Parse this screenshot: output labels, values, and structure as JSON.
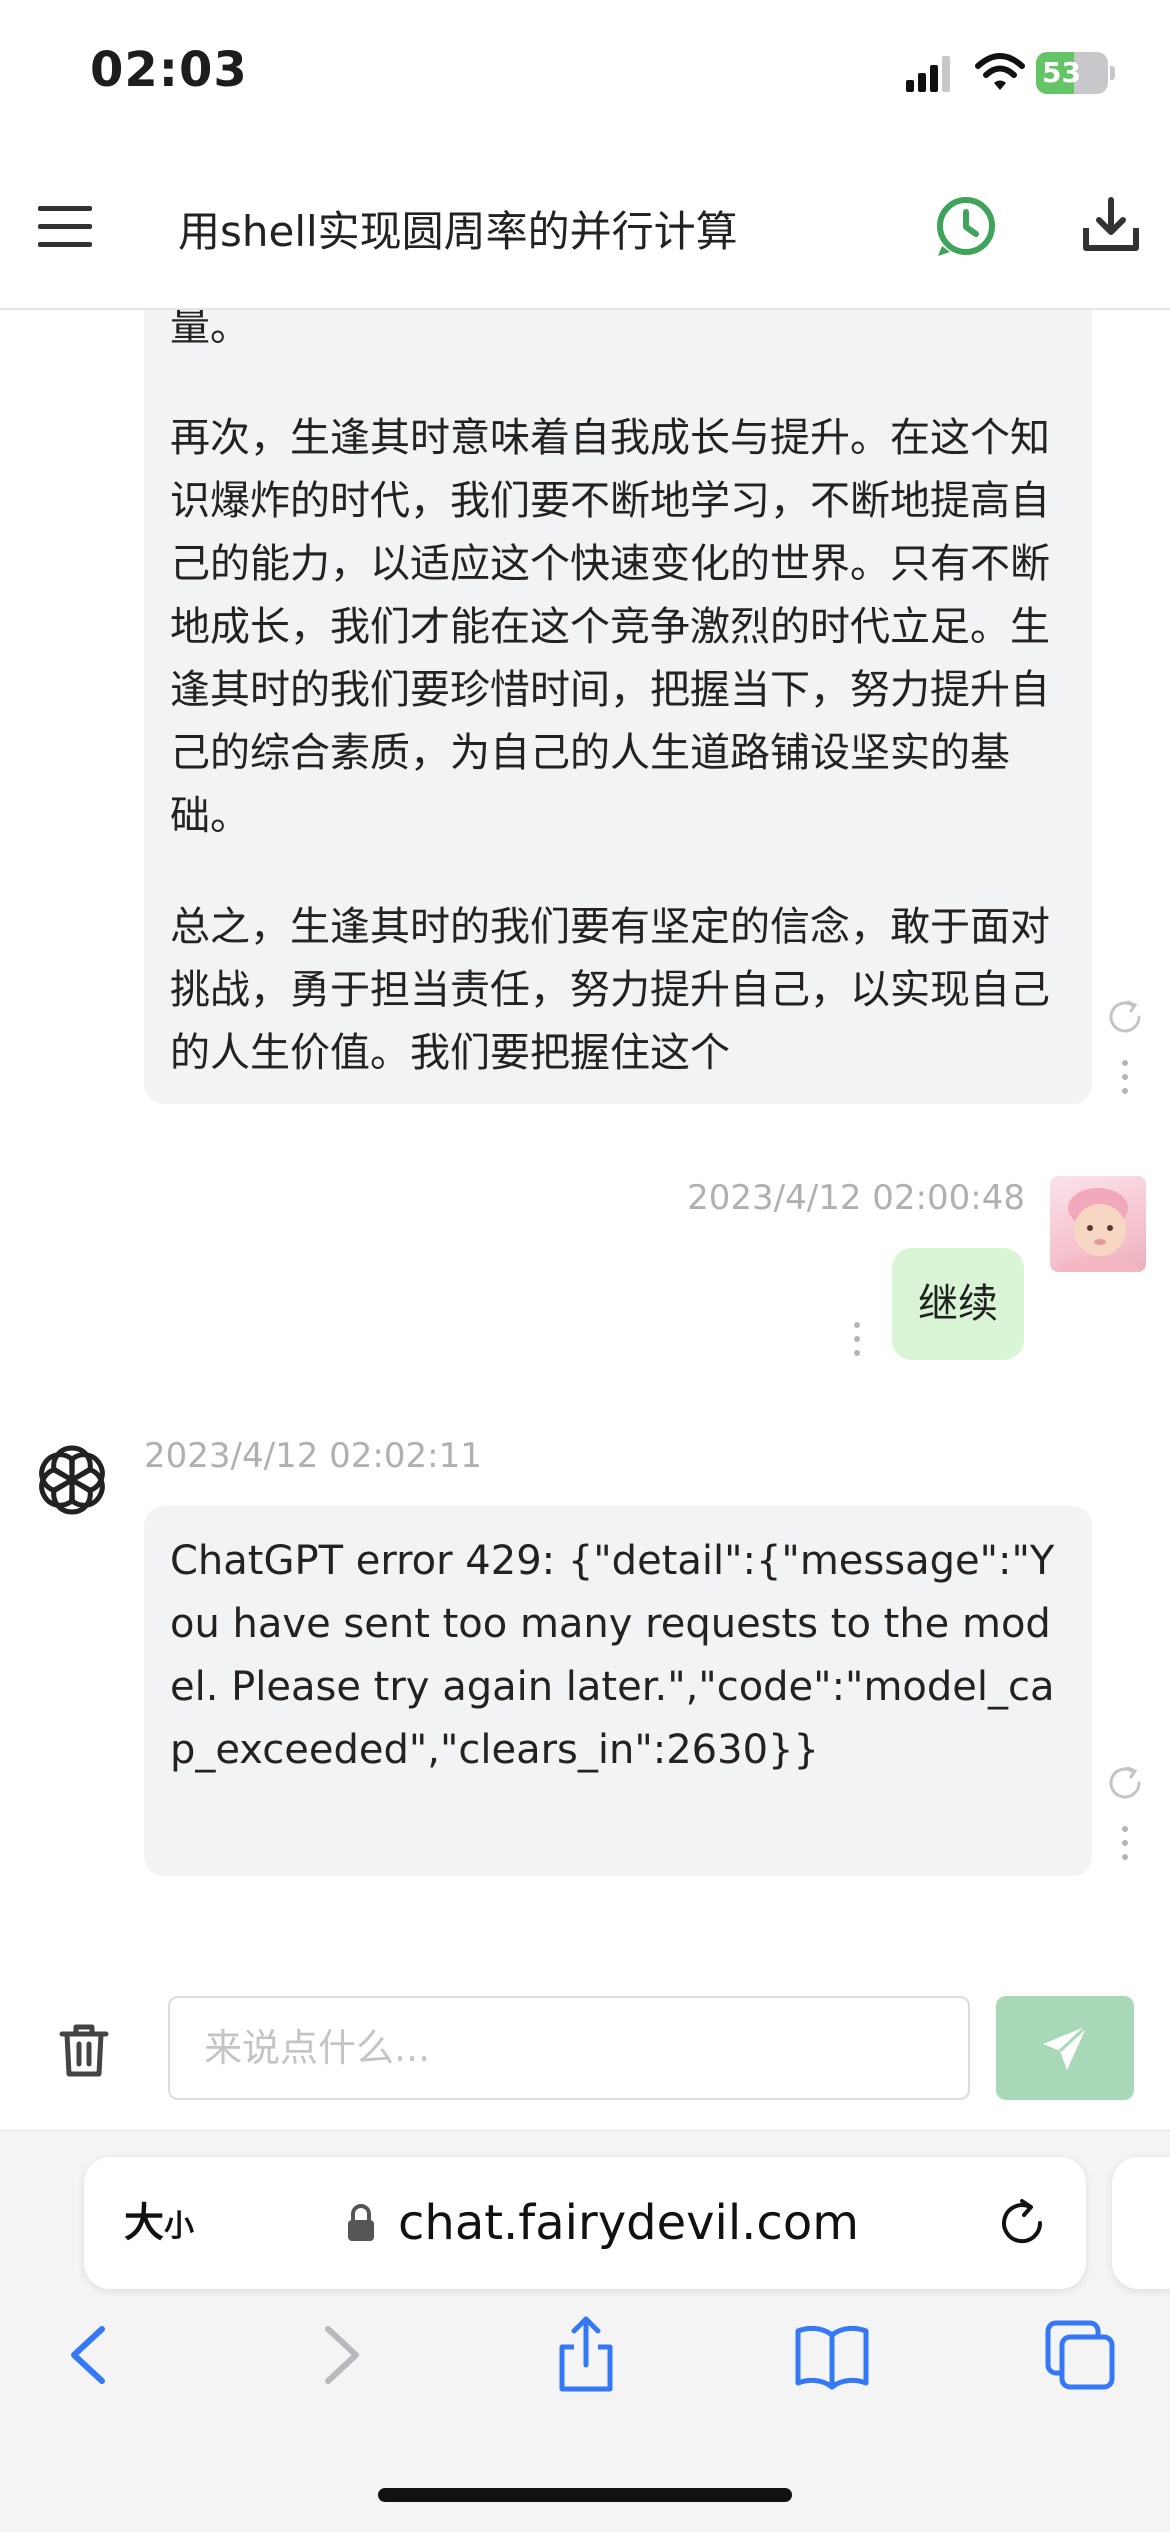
{
  "status_bar": {
    "time": "02:03",
    "battery_level": "53",
    "battery_fraction": 0.53
  },
  "header": {
    "title": "用shell实现圆周率的并行计算"
  },
  "messages": [
    {
      "role": "assistant",
      "paragraphs": [
        "量。",
        "再次，生逢其时意味着自我成长与提升。在这个知识爆炸的时代，我们要不断地学习，不断地提高自己的能力，以适应这个快速变化的世界。只有不断地成长，我们才能在这个竞争激烈的时代立足。生逢其时的我们要珍惜时间，把握当下，努力提升自己的综合素质，为自己的人生道路铺设坚实的基础。",
        "总之，生逢其时的我们要有坚定的信念，敢于面对挑战，勇于担当责任，努力提升自己，以实现自己的人生价值。我们要把握住这个"
      ]
    },
    {
      "role": "user",
      "timestamp": "2023/4/12 02:00:48",
      "text": "继续"
    },
    {
      "role": "assistant",
      "timestamp": "2023/4/12 02:02:11",
      "text": "ChatGPT error 429: {\"detail\":{\"message\":\"You have sent too many requests to the model. Please try again later.\",\"code\":\"model_cap_exceeded\",\"clears_in\":2630}}"
    }
  ],
  "composer": {
    "placeholder": "来说点什么...",
    "value": ""
  },
  "browser": {
    "text_size_label_big": "大",
    "text_size_label_small": "小",
    "url": "chat.fairydevil.com"
  },
  "colors": {
    "accent_green": "#3fa35b",
    "send_button": "#a7d9b8",
    "user_bubble": "#d9f5d6",
    "bot_bubble": "#f2f3f5",
    "safari_blue": "#3478f6"
  },
  "icons": {
    "menu": "hamburger-icon",
    "history": "clock-history-icon",
    "download": "download-icon",
    "trash": "trash-icon",
    "send": "paper-plane-icon",
    "lock": "lock-icon",
    "reload": "reload-icon",
    "back": "chevron-left-icon",
    "forward": "chevron-right-icon",
    "share": "share-icon",
    "bookmarks": "book-icon",
    "tabs": "tabs-icon"
  }
}
